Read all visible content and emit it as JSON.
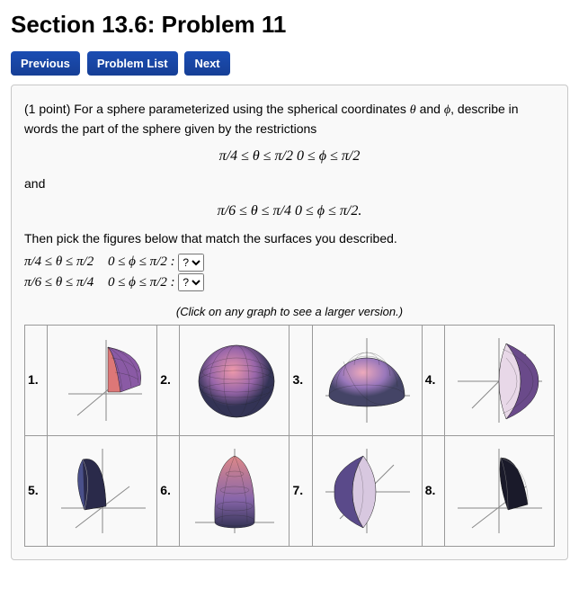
{
  "title": "Section 13.6: Problem 11",
  "nav": {
    "prev": "Previous",
    "list": "Problem List",
    "next": "Next"
  },
  "problem": {
    "points_prefix": "(1 point) For a sphere parameterized using the spherical coordinates ",
    "theta": "θ",
    "and_word": " and ",
    "phi": "ϕ",
    "intro_suffix": ", describe in words the part of the sphere given by the restrictions",
    "eq1": "π/4 ≤ θ ≤ π/2     0 ≤ ϕ ≤ π/2",
    "and": "and",
    "eq2": "π/6 ≤ θ ≤ π/4     0 ≤ ϕ ≤ π/2.",
    "then": "Then pick the figures below that match the surfaces you described.",
    "ans1_left": "π/4 ≤ θ ≤ π/2",
    "ans1_right": "0 ≤ ϕ ≤ π/2 :",
    "ans2_left": "π/6 ≤ θ ≤ π/4",
    "ans2_right": "0 ≤ ϕ ≤ π/2 :",
    "select_placeholder": "?",
    "hint": "(Click on any graph to see a larger version.)"
  },
  "cells": {
    "c1": "1.",
    "c2": "2.",
    "c3": "3.",
    "c4": "4.",
    "c5": "5.",
    "c6": "6.",
    "c7": "7.",
    "c8": "8."
  }
}
